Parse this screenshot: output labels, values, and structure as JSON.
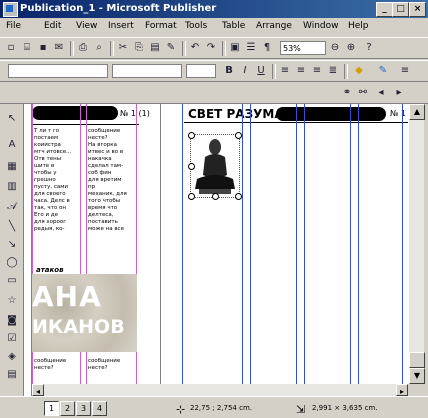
{
  "window": {
    "title": "Publication_1 - Microsoft Publisher"
  },
  "menu": [
    "File",
    "Edit",
    "View",
    "Insert",
    "Format",
    "Tools",
    "Table",
    "Arrange",
    "Window",
    "Help"
  ],
  "toolbar": {
    "zoom": "53%"
  },
  "doc": {
    "left_header": "№ 1 (1)",
    "right_title": "СВЕТ РАЗУМА",
    "right_num": "№ 1",
    "col1_text": "Т ли т го\nпостаем\nкоиистра\nмтч итовсе...\nОтв тены\nшите в\nчтобы у\nгрешно\nпусту, сами\nдля своего\nчаса. Делс в\nтак, что он\nЕго и де\nдля хороог\nредыя, ко-",
    "col2_text": "сообщение\nнесте?\nНа вгорка\nитвес и во в\nнакачка\nсделал там-\nсоб фин\nдля вретим\nпр\nмеханик, для\nтого чтобы\nвремя что\nделтеса,\nпоставить\nможе на все",
    "caption": "атаков",
    "big_line1": "АНА",
    "big_line2": "ИКАНОВ",
    "bottom_text1": "сообщение\nнесте?",
    "bottom_text2": "сообщение\nнесте?"
  },
  "status": {
    "pages": [
      "1",
      "2",
      "3",
      "4"
    ],
    "position": "22,75 ; 2,754 cm.",
    "size": "2,991 × 3,635 cm."
  },
  "colors": {
    "titlebar": "#0a246a",
    "guide": "#3050d0"
  }
}
